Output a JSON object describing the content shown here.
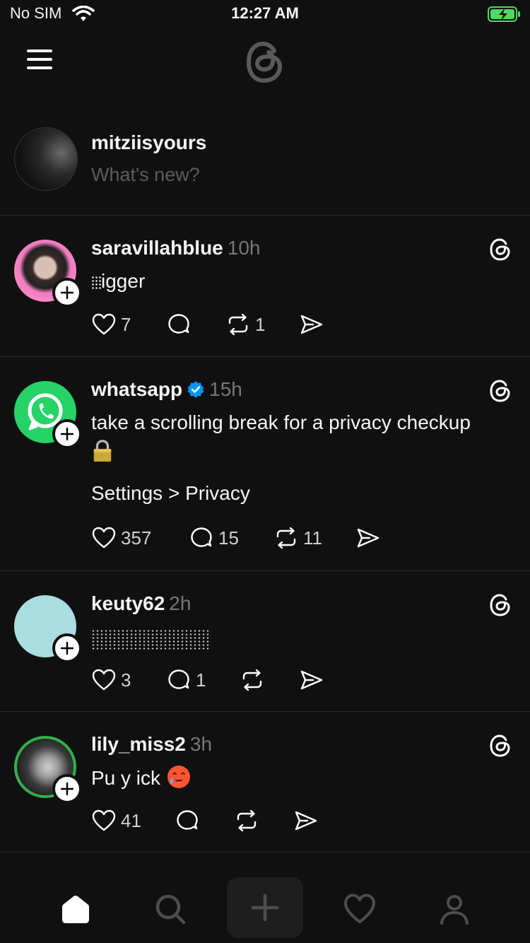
{
  "status_bar": {
    "carrier": "No SIM",
    "time": "12:27 AM"
  },
  "composer": {
    "username": "mitziisyours",
    "placeholder": "What's new?"
  },
  "posts": [
    {
      "username": "saravillahblue",
      "time": "10h",
      "text": "igger",
      "likes": "7",
      "replies": "",
      "reposts": "1"
    },
    {
      "username": "whatsapp",
      "verified": true,
      "time": "15h",
      "text": "take a scrolling break for a privacy checkup",
      "text2": "Settings > Privacy",
      "likes": "357",
      "replies": "15",
      "reposts": "11"
    },
    {
      "username": "keuty62",
      "time": "2h",
      "text": "",
      "likes": "3",
      "replies": "1",
      "reposts": ""
    },
    {
      "username": "lily_miss2",
      "time": "3h",
      "text": "Pu y ick",
      "likes": "41",
      "replies": "",
      "reposts": ""
    }
  ],
  "colors": {
    "background": "#101010",
    "verified": "#0095f6",
    "whatsapp_green": "#25d366",
    "battery_green": "#4cd964"
  }
}
